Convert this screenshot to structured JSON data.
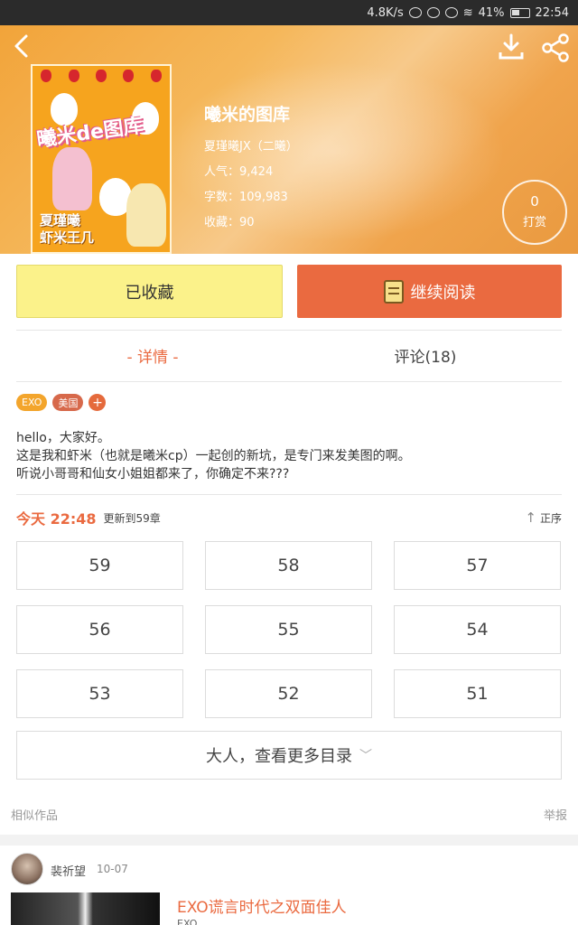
{
  "status_bar": {
    "speed": "4.8K/s",
    "battery": "41%",
    "time": "22:54"
  },
  "book": {
    "cover_title": "曦米de图库",
    "cover_author_line1": "夏瑾曦",
    "cover_author_line2": "虾米王几",
    "title": "曦米的图库",
    "author": "夏瑾曦JX（二曦）",
    "popularity": "人气：9,424",
    "word_count": "字数：109,983",
    "favorites": "收藏：90",
    "tip_count": "0",
    "tip_label": "打赏"
  },
  "actions": {
    "collected_label": "已收藏",
    "read_label": "继续阅读"
  },
  "tabs": [
    {
      "label": "- 详情 -",
      "active": true
    },
    {
      "label": "评论(18)",
      "active": false
    }
  ],
  "tags": [
    "EXO",
    "美国",
    "+"
  ],
  "description": [
    "hello，大家好。",
    "这是我和虾米（也就是曦米cp）一起创的新坑，是专门来发美图的啊。",
    "听说小哥哥和仙女小姐姐都来了，你确定不来???"
  ],
  "update": {
    "time": "今天 22:48",
    "text": "更新到59章",
    "sort_label": "正序"
  },
  "chapters": [
    "59",
    "58",
    "57",
    "56",
    "55",
    "54",
    "53",
    "52",
    "51"
  ],
  "more_label": "大人，查看更多目录",
  "similar": {
    "section_label": "相似作品",
    "report_label": "举报",
    "author_name": "裴祈望",
    "date": "10-07",
    "work_title": "EXO谎言时代之双面佳人",
    "work_sub": "EXO"
  },
  "colors": {
    "accent": "#ea6a40",
    "collected_bg": "#fbf28a",
    "header": "#f2a43a"
  }
}
